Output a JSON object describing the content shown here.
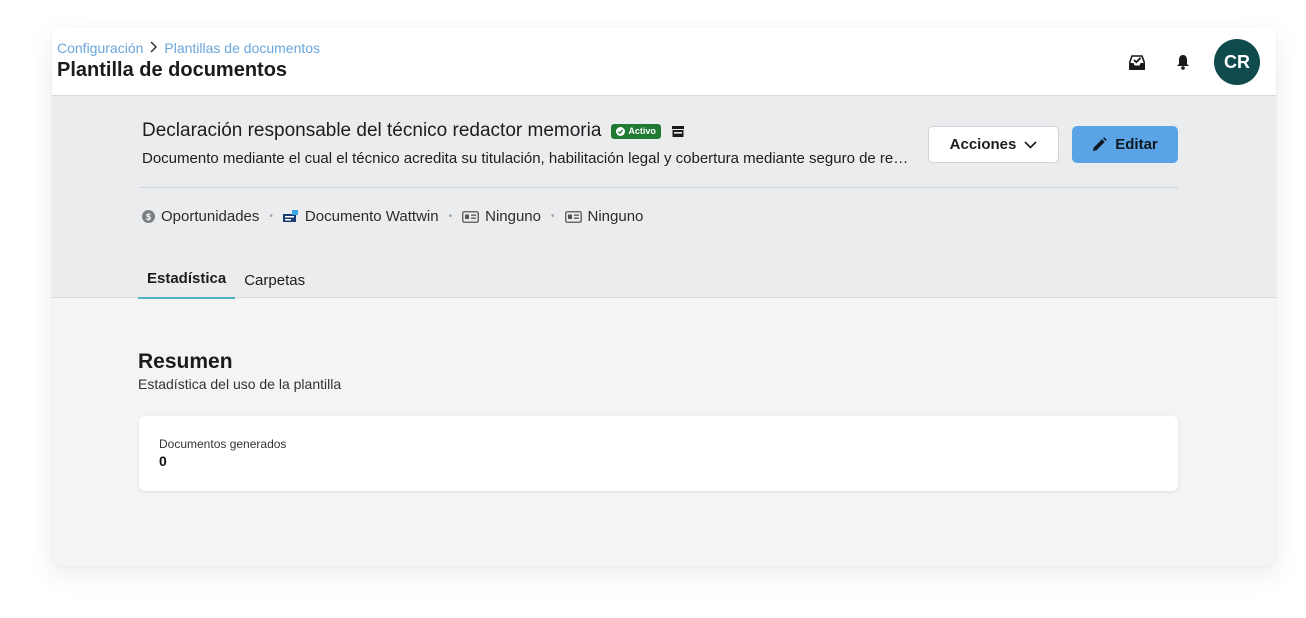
{
  "header": {
    "breadcrumb": [
      "Configuración",
      "Plantillas de documentos"
    ],
    "breadcrumb_separator": ">",
    "title": "Plantilla de documentos",
    "icons": [
      "inbox-check-icon",
      "bell-icon"
    ],
    "avatar_initials": "CR"
  },
  "document": {
    "title": "Declaración responsable del técnico redactor memoria",
    "status_badge": "Activo",
    "description": "Documento mediante el cual el técnico acredita su titulación, habilitación legal y cobertura mediante seguro de responsabilidad civil",
    "actions_label": "Acciones",
    "edit_label": "Editar",
    "meta": [
      {
        "icon": "dollar-circle-icon",
        "label": "Oportunidades"
      },
      {
        "icon": "wattwin-doc-icon",
        "label": "Documento Wattwin"
      },
      {
        "icon": "id-card-icon",
        "label": "Ninguno"
      },
      {
        "icon": "id-card-icon",
        "label": "Ninguno"
      }
    ]
  },
  "tabs": [
    {
      "label": "Estadística",
      "active": true
    },
    {
      "label": "Carpetas",
      "active": false
    }
  ],
  "summary": {
    "title": "Resumen",
    "subtitle": "Estadística del uso de la plantilla",
    "stat_label": "Documentos generados",
    "stat_value": "0"
  },
  "colors": {
    "accent": "#5aa3e6",
    "avatar_bg": "#0f4a4d",
    "badge_active": "#1f7a32",
    "tab_underline": "#4fb3c2",
    "breadcrumb_link": "#6aa6dc"
  }
}
